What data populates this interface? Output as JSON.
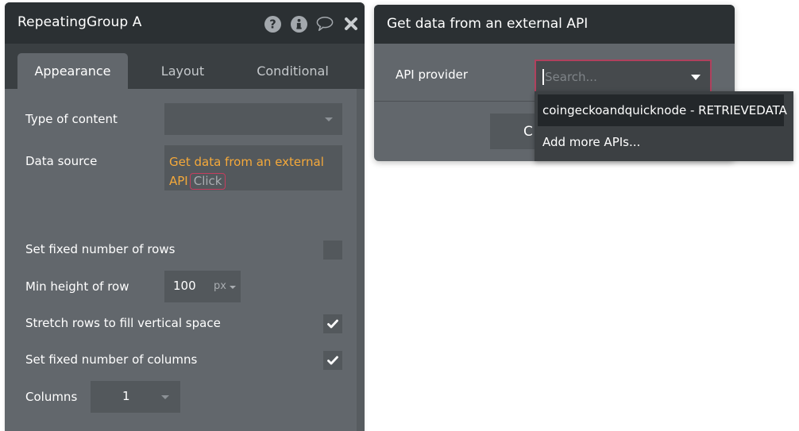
{
  "property_editor": {
    "title": "RepeatingGroup A",
    "header_icons": [
      "help-icon",
      "info-icon",
      "comment-icon",
      "close-icon"
    ],
    "tabs": [
      {
        "label": "Appearance",
        "active": true
      },
      {
        "label": "Layout",
        "active": false
      },
      {
        "label": "Conditional",
        "active": false
      }
    ],
    "fields": {
      "type_of_content": {
        "label": "Type of content",
        "value": ""
      },
      "data_source": {
        "label": "Data source",
        "value": "Get data from an external API",
        "chip": "Click"
      },
      "set_fixed_rows": {
        "label": "Set fixed number of rows",
        "checked": false
      },
      "min_height_row": {
        "label": "Min height of row",
        "value": "100",
        "unit": "px"
      },
      "stretch_rows": {
        "label": "Stretch rows to fill vertical space",
        "checked": true
      },
      "set_fixed_columns": {
        "label": "Set fixed number of columns",
        "checked": true
      },
      "columns": {
        "label": "Columns",
        "value": "1"
      }
    }
  },
  "api_popup": {
    "title": "Get data from an external API",
    "api_provider_label": "API provider",
    "search_placeholder": "Search...",
    "search_value": "",
    "hidden_button_partial": "C",
    "dropdown_options": [
      {
        "label": "coingeckoandquicknode - RETRIEVEDATA",
        "highlighted": true
      },
      {
        "label": "Add more APIs...",
        "highlighted": false
      }
    ]
  },
  "colors": {
    "header_bg": "#2b3033",
    "panel_bg": "#62676c",
    "dynamic_text": "#f5a93a",
    "focus_border": "#b0415e"
  }
}
